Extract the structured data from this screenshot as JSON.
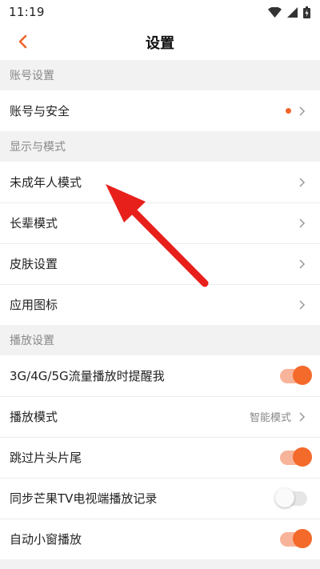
{
  "status_bar": {
    "time": "11:19"
  },
  "header": {
    "title": "设置"
  },
  "sections": [
    {
      "title": "账号设置"
    },
    {
      "title": "显示与模式"
    },
    {
      "title": "播放设置"
    }
  ],
  "rows": {
    "account_security": {
      "label": "账号与安全",
      "has_dot": true
    },
    "minor_mode": {
      "label": "未成年人模式"
    },
    "elder_mode": {
      "label": "长辈模式"
    },
    "skin_settings": {
      "label": "皮肤设置"
    },
    "app_icon": {
      "label": "应用图标"
    },
    "mobile_data_reminder": {
      "label": "3G/4G/5G流量播放时提醒我",
      "toggle": "on"
    },
    "play_mode": {
      "label": "播放模式",
      "value": "智能模式"
    },
    "skip_intro_outro": {
      "label": "跳过片头片尾",
      "toggle": "on"
    },
    "sync_tv_history": {
      "label": "同步芒果TV电视端播放记录",
      "toggle": "off"
    },
    "auto_mini_window": {
      "label": "自动小窗播放",
      "toggle": "on"
    }
  },
  "colors": {
    "accent": "#f46a2b",
    "toggle_track_on": "#f7b49a",
    "annotation_arrow": "#e8201c"
  }
}
